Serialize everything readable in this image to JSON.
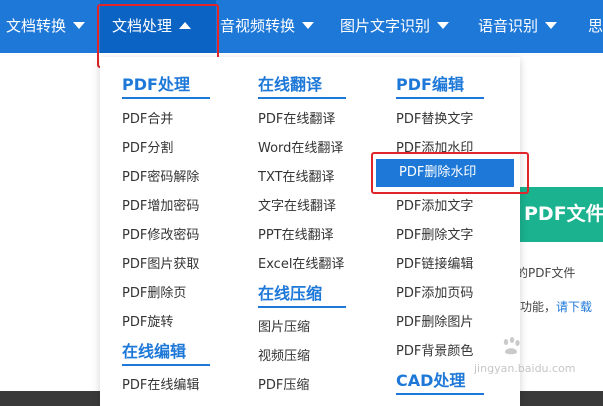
{
  "colors": {
    "nav_bg": "#1e78d8",
    "nav_active_bg": "#0b63c4",
    "accent": "#1e78d8",
    "highlight_border": "#e0262a",
    "hero_green": "#1bb28f"
  },
  "nav": {
    "items": [
      {
        "label": "文档转换"
      },
      {
        "label": "文档处理"
      },
      {
        "label": "音视频转换"
      },
      {
        "label": "图片文字识别"
      },
      {
        "label": "语音识别"
      },
      {
        "label": "思"
      }
    ]
  },
  "menu": {
    "columns": [
      {
        "sections": [
          {
            "title": "PDF处理",
            "items": [
              "PDF合并",
              "PDF分割",
              "PDF密码解除",
              "PDF增加密码",
              "PDF修改密码",
              "PDF图片获取",
              "PDF删除页",
              "PDF旋转"
            ]
          },
          {
            "title": "在线编辑",
            "items": [
              "PDF在线编辑"
            ]
          }
        ]
      },
      {
        "sections": [
          {
            "title": "在线翻译",
            "items": [
              "PDF在线翻译",
              "Word在线翻译",
              "TXT在线翻译",
              "文字在线翻译",
              "PPT在线翻译",
              "Excel在线翻译"
            ]
          },
          {
            "title": "在线压缩",
            "items": [
              "图片压缩",
              "视频压缩",
              "PDF压缩"
            ]
          }
        ]
      },
      {
        "sections": [
          {
            "title": "PDF编辑",
            "items": [
              "PDF替换文字",
              "PDF添加水印",
              "PDF删除水印",
              "PDF添加文字",
              "PDF删除文字",
              "PDF链接编辑",
              "PDF添加页码",
              "PDF删除图片",
              "PDF背景颜色"
            ]
          },
          {
            "title": "CAD处理",
            "items": []
          }
        ]
      }
    ]
  },
  "background": {
    "hero_title": "PDF文件",
    "line1": "的PDF文件",
    "line2_prefix": "功能，",
    "line2_link": "请下载"
  },
  "watermark": {
    "text": "jingyan.baidu.com"
  }
}
